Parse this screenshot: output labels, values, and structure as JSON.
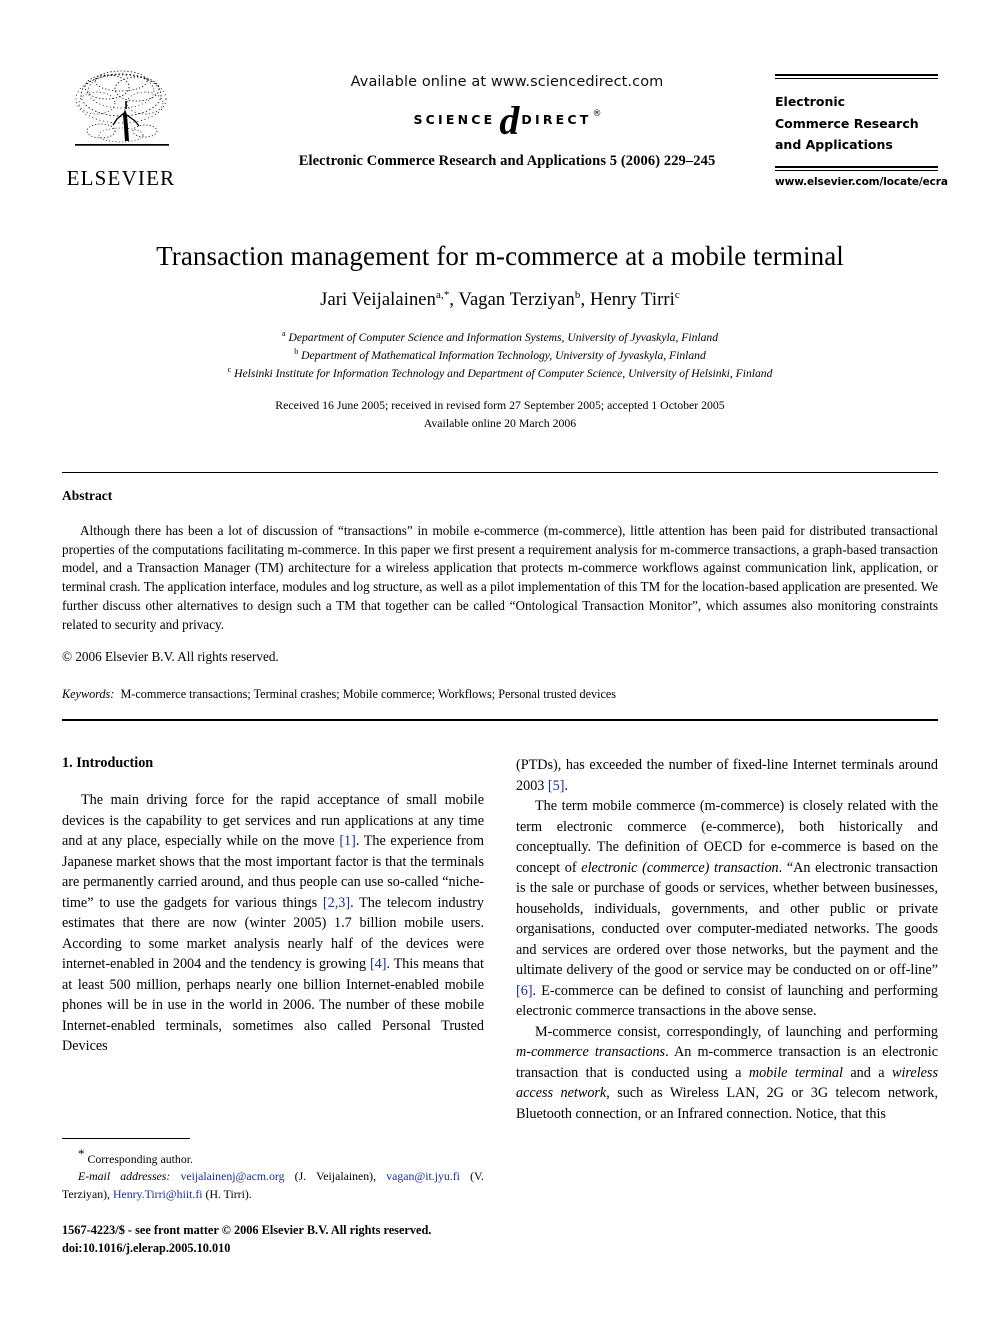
{
  "header": {
    "available_online": "Available online at www.sciencedirect.com",
    "sciencedirect": {
      "science": "SCIENCE",
      "at": "d",
      "direct": "DIRECT",
      "tm": "®"
    },
    "journal_reference": "Electronic Commerce Research and Applications 5 (2006) 229–245",
    "publisher_wordmark": "ELSEVIER",
    "journal_box": {
      "line1": "Electronic",
      "line2": "Commerce Research",
      "line3": "and Applications",
      "url": "www.elsevier.com/locate/ecra"
    }
  },
  "title": "Transaction management for m-commerce at a mobile terminal",
  "authors": {
    "full": "Jari Veijalainen a,*, Vagan Terziyan b, Henry Tirri c",
    "a_name": "Jari Veijalainen",
    "a_mark": "a,*",
    "b_name": "Vagan Terziyan",
    "b_mark": "b",
    "c_name": "Henry Tirri",
    "c_mark": "c"
  },
  "affiliations": [
    {
      "mark": "a",
      "text": "Department of Computer Science and Information Systems, University of Jyvaskyla, Finland"
    },
    {
      "mark": "b",
      "text": "Department of Mathematical Information Technology, University of Jyvaskyla, Finland"
    },
    {
      "mark": "c",
      "text": "Helsinki Institute for Information Technology and Department of Computer Science, University of Helsinki, Finland"
    }
  ],
  "dates": {
    "received": "Received 16 June 2005; received in revised form 27 September 2005; accepted 1 October 2005",
    "available_online": "Available online 20 March 2006"
  },
  "abstract": {
    "heading": "Abstract",
    "body": "Although there has been a lot of discussion of “transactions” in mobile e-commerce (m-commerce), little attention has been paid for distributed transactional properties of the computations facilitating m-commerce. In this paper we first present a requirement analysis for m-commerce transactions, a graph-based transaction model, and a Transaction Manager (TM) architecture for a wireless application that protects m-commerce workflows against communication link, application, or terminal crash. The application interface, modules and log structure, as well as a pilot implementation of this TM for the location-based application are presented. We further discuss other alternatives to design such a TM that together can be called “Ontological Transaction Monitor”, which assumes also monitoring constraints related to security and privacy.",
    "copyright": "© 2006 Elsevier B.V. All rights reserved.",
    "keywords_label": "Keywords:",
    "keywords_value": "M-commerce transactions; Terminal crashes; Mobile commerce; Workflows; Personal trusted devices"
  },
  "body": {
    "section_heading": "1. Introduction",
    "left_column": {
      "para1_part1": "The main driving force for the rapid acceptance of small mobile devices is the capability to get services and run applications at any time and at any place, especially while on the move ",
      "cite1": "[1]",
      "para1_part2": ". The experience from Japanese market shows that the most important factor is that the terminals are permanently carried around, and thus people can use so-called “niche-time” to use the gadgets for various things ",
      "cite2": "[2,3]",
      "para1_part3": ". The telecom industry estimates that there are now (winter 2005) 1.7 billion mobile users. According to some market analysis nearly half of the devices were internet-enabled in 2004 and the tendency is growing ",
      "cite3": "[4]",
      "para1_part4": ". This means that at least 500 million, perhaps nearly one billion Internet-enabled mobile phones will be in use in the world in 2006. The number of these mobile Internet-enabled terminals, sometimes also called Personal Trusted Devices"
    },
    "right_column": {
      "para1_cont_part1": "(PTDs), has exceeded the number of fixed-line Internet terminals around 2003 ",
      "cite5": "[5]",
      "para1_cont_part2": ".",
      "para2_part1": "The term mobile commerce (m-commerce) is closely related with the term electronic commerce (e-commerce), both historically and conceptually. The definition of OECD for e-commerce is based on the concept of ",
      "para2_italic1": "electronic (commerce) transaction",
      "para2_part2": ". “An electronic transaction is the sale or purchase of goods or services, whether between businesses, households, individuals, governments, and other public or private organisations, conducted over computer-mediated networks. The goods and services are ordered over those networks, but the payment and the ultimate delivery of the good or service may be conducted on or off-line” ",
      "cite6": "[6]",
      "para2_part3": ". E-commerce can be defined to consist of launching and performing electronic commerce transactions in the above sense.",
      "para3_part1": "M-commerce consist, correspondingly, of launching and performing ",
      "para3_italic1": "m-commerce transactions",
      "para3_part2": ". An m-commerce transaction is an electronic transaction that is conducted using a ",
      "para3_italic2": "mobile terminal",
      "para3_part3": " and a ",
      "para3_italic3": "wireless access network,",
      "para3_part4": " such as Wireless LAN, 2G or 3G telecom network, Bluetooth connection, or an Infrared connection. Notice, that this"
    }
  },
  "footnote": {
    "star": "*",
    "corresponding": "Corresponding author.",
    "email_label": "E-mail addresses:",
    "email1": "veijalainenj@acm.org",
    "email1_owner": "(J. Veijalainen),",
    "email2": "vagan@it.jyu.fi",
    "email2_owner": "(V. Terziyan),",
    "email3": "Henry.Tirri@hiit.fi",
    "email3_owner": "(H. Tirri)."
  },
  "imprint": {
    "line1": "1567-4223/$ - see front matter © 2006 Elsevier B.V. All rights reserved.",
    "line2": "doi:10.1016/j.elerap.2005.10.010"
  },
  "colors": {
    "link": "#1b2f86",
    "text": "#000000",
    "background": "#ffffff"
  }
}
